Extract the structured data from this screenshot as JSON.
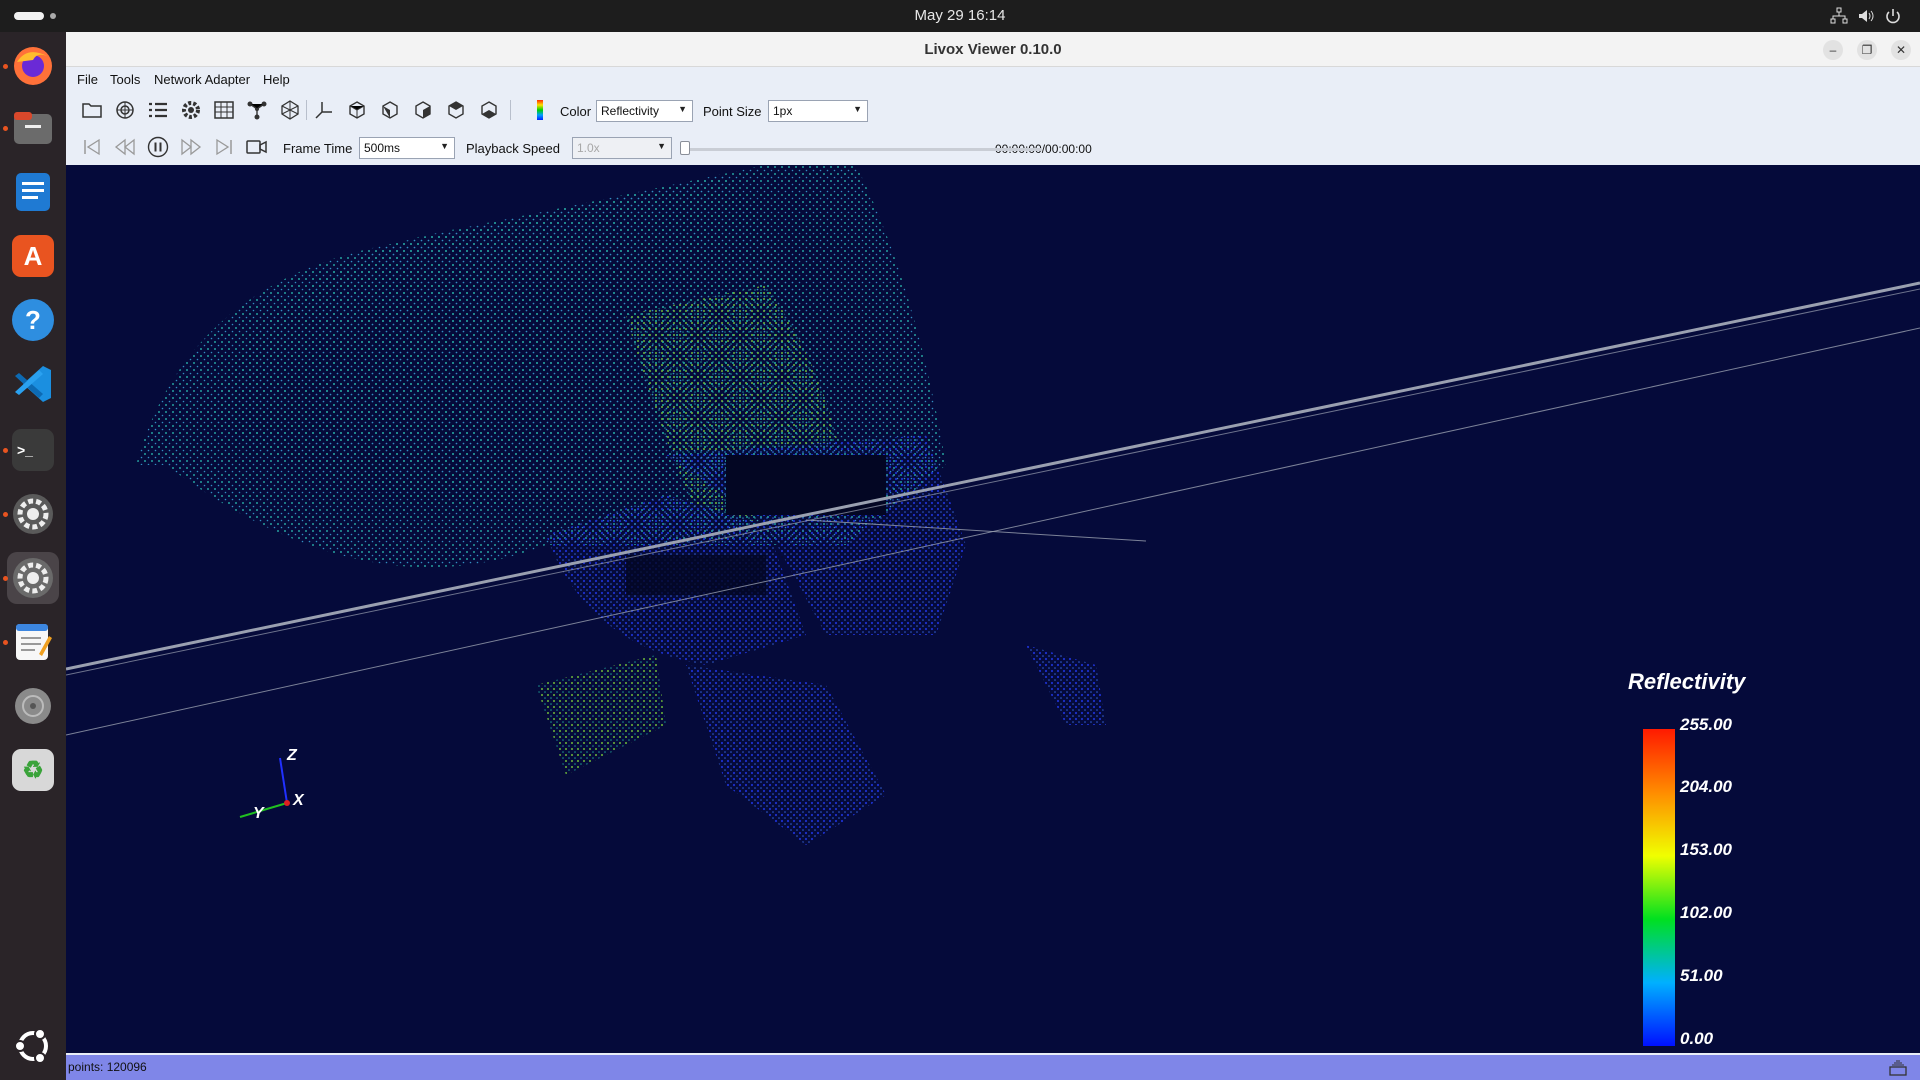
{
  "topbar": {
    "clock": "May 29  16:14"
  },
  "dock": {
    "items": [
      {
        "name": "firefox",
        "glyph": ""
      },
      {
        "name": "files",
        "glyph": ""
      },
      {
        "name": "writer",
        "glyph": ""
      },
      {
        "name": "app-center",
        "glyph": "A"
      },
      {
        "name": "help",
        "glyph": "?"
      },
      {
        "name": "vscode",
        "glyph": ""
      },
      {
        "name": "terminal",
        "glyph": ">_"
      },
      {
        "name": "settings",
        "glyph": ""
      },
      {
        "name": "settings-active",
        "glyph": ""
      },
      {
        "name": "text-editor",
        "glyph": ""
      },
      {
        "name": "disc",
        "glyph": ""
      },
      {
        "name": "trash",
        "glyph": "♻"
      }
    ]
  },
  "window": {
    "title": "Livox Viewer 0.10.0",
    "menu": [
      "File",
      "Tools",
      "Network Adapter",
      "Help"
    ],
    "toolbar": {
      "color_label": "Color",
      "color_value": "Reflectivity",
      "point_size_label": "Point Size",
      "point_size_value": "1px",
      "frame_time_label": "Frame Time",
      "frame_time_value": "500ms",
      "playback_speed_label": "Playback Speed",
      "playback_speed_value": "1.0x",
      "time_readout": "00:00:00/00:00:00",
      "playback_progress": 0
    },
    "viewport": {
      "legend": {
        "title": "Reflectivity",
        "ticks": [
          "255.00",
          "204.00",
          "153.00",
          "102.00",
          "51.00",
          "0.00"
        ]
      },
      "axes": {
        "z": "Z",
        "x": "X",
        "y": "Y"
      }
    },
    "status": {
      "points": "points: 120096"
    }
  },
  "colors": {
    "viewport_bg": "#050a3a",
    "statusbar": "#7f86e8"
  }
}
